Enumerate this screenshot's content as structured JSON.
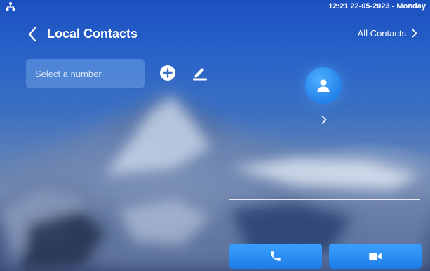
{
  "status_bar": {
    "datetime": "12:21  22-05-2023 - Monday",
    "network_icon": "network-tree-icon"
  },
  "header": {
    "back_icon": "chevron-left-icon",
    "title": "Local Contacts",
    "all_contacts_label": "All Contacts",
    "all_contacts_icon": "chevron-right-icon"
  },
  "search": {
    "placeholder": "Select a number",
    "value": ""
  },
  "toolbar": {
    "add_icon": "plus-circle-icon",
    "edit_icon": "pencil-icon"
  },
  "detail": {
    "avatar_icon": "person-icon",
    "expand_icon": "chevron-right-icon",
    "fields": [
      "",
      "",
      "",
      ""
    ]
  },
  "actions": {
    "audio_call_icon": "phone-icon",
    "video_call_icon": "video-camera-icon"
  },
  "colors": {
    "accent": "#2a8cf5",
    "text": "#ffffff"
  }
}
